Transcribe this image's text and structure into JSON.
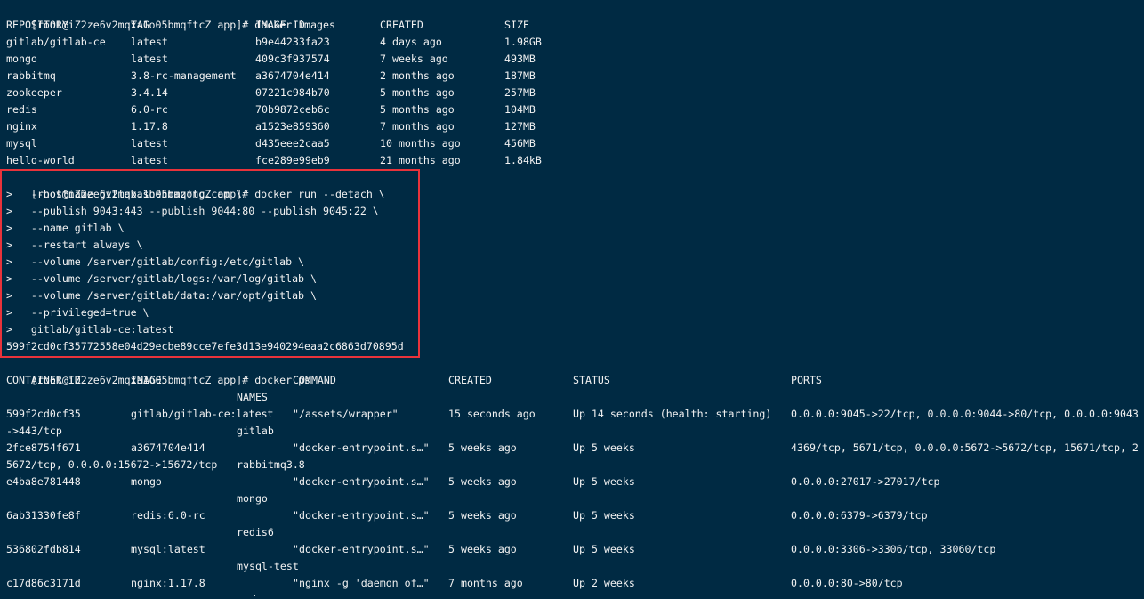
{
  "prompt": "[root@iZ2ze6v2mqxa1o05bmqftcZ app]# ",
  "images_cmd": "docker images",
  "images_headers": [
    "REPOSITORY",
    "TAG",
    "IMAGE ID",
    "CREATED",
    "SIZE"
  ],
  "images_rows": [
    [
      "gitlab/gitlab-ce",
      "latest",
      "b9e44233fa23",
      "4 days ago",
      "1.98GB"
    ],
    [
      "mongo",
      "latest",
      "409c3f937574",
      "7 weeks ago",
      "493MB"
    ],
    [
      "rabbitmq",
      "3.8-rc-management",
      "a3674704e414",
      "2 months ago",
      "187MB"
    ],
    [
      "zookeeper",
      "3.4.14",
      "07221c984b70",
      "5 months ago",
      "257MB"
    ],
    [
      "redis",
      "6.0-rc",
      "70b9872ceb6c",
      "5 months ago",
      "104MB"
    ],
    [
      "nginx",
      "1.17.8",
      "a1523e859360",
      "7 months ago",
      "127MB"
    ],
    [
      "mysql",
      "latest",
      "d435eee2caa5",
      "10 months ago",
      "456MB"
    ],
    [
      "hello-world",
      "latest",
      "fce289e99eb9",
      "21 months ago",
      "1.84kB"
    ]
  ],
  "run_cmd": "docker run --detach \\",
  "run_continuations": [
    ">   --hostname gitlab.shenmazong.com \\",
    ">   --publish 9043:443 --publish 9044:80 --publish 9045:22 \\",
    ">   --name gitlab \\",
    ">   --restart always \\",
    ">   --volume /server/gitlab/config:/etc/gitlab \\",
    ">   --volume /server/gitlab/logs:/var/log/gitlab \\",
    ">   --volume /server/gitlab/data:/var/opt/gitlab \\",
    ">   --privileged=true \\",
    ">   gitlab/gitlab-ce:latest"
  ],
  "run_output": "599f2cd0cf35772558e04d29ecbe89cce7efe3d13e940294eaa2c6863d70895d",
  "ps_cmd": "docker ps",
  "ps_headers": [
    "CONTAINER ID",
    "IMAGE",
    "COMMAND",
    "CREATED",
    "STATUS",
    "PORTS"
  ],
  "ps_names_header": "NAMES",
  "ps_rows": [
    {
      "id": "599f2cd0cf35",
      "image": "gitlab/gitlab-ce:latest",
      "command": "\"/assets/wrapper\"",
      "created": "15 seconds ago",
      "status": "Up 14 seconds (health: starting)",
      "ports": "0.0.0.0:9045->22/tcp, 0.0.0.0:9044->80/tcp, 0.0.0.0:9043",
      "ports_cont": "->443/tcp",
      "name": "gitlab"
    },
    {
      "id": "2fce8754f671",
      "image": "a3674704e414",
      "command": "\"docker-entrypoint.s…\"",
      "created": "5 weeks ago",
      "status": "Up 5 weeks",
      "ports": "4369/tcp, 5671/tcp, 0.0.0.0:5672->5672/tcp, 15671/tcp, 2",
      "ports_cont": "5672/tcp, 0.0.0.0:15672->15672/tcp",
      "name": "rabbitmq3.8"
    },
    {
      "id": "e4ba8e781448",
      "image": "mongo",
      "command": "\"docker-entrypoint.s…\"",
      "created": "5 weeks ago",
      "status": "Up 5 weeks",
      "ports": "0.0.0.0:27017->27017/tcp",
      "ports_cont": "",
      "name": "mongo"
    },
    {
      "id": "6ab31330fe8f",
      "image": "redis:6.0-rc",
      "command": "\"docker-entrypoint.s…\"",
      "created": "5 weeks ago",
      "status": "Up 5 weeks",
      "ports": "0.0.0.0:6379->6379/tcp",
      "ports_cont": "",
      "name": "redis6"
    },
    {
      "id": "536802fdb814",
      "image": "mysql:latest",
      "command": "\"docker-entrypoint.s…\"",
      "created": "5 weeks ago",
      "status": "Up 5 weeks",
      "ports": "0.0.0.0:3306->3306/tcp, 33060/tcp",
      "ports_cont": "",
      "name": "mysql-test"
    },
    {
      "id": "c17d86c3171d",
      "image": "nginx:1.17.8",
      "command": "\"nginx -g 'daemon of…\"",
      "created": "7 months ago",
      "status": "Up 2 weeks",
      "ports": "0.0.0.0:80->80/tcp",
      "ports_cont": "",
      "name": ""
    }
  ],
  "colors": {
    "background": "#002a43",
    "text": "#f2f2f2",
    "highlight_border": "#e8333b"
  }
}
